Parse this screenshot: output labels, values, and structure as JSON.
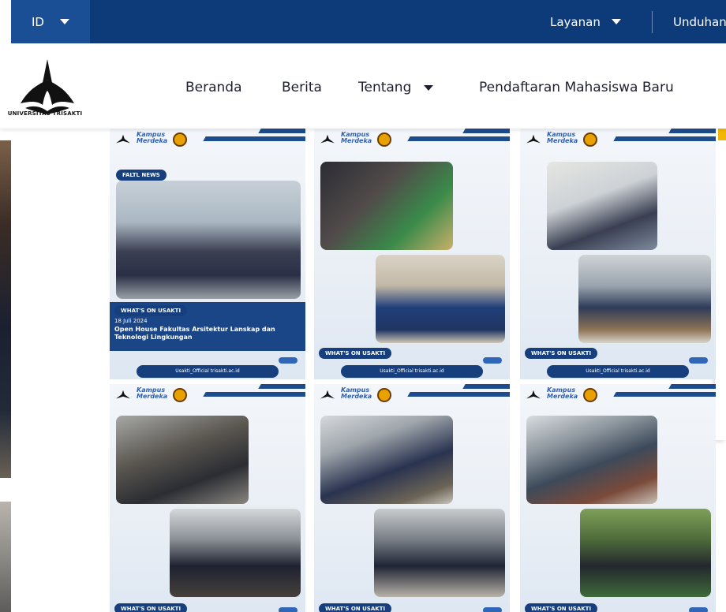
{
  "topbar": {
    "language": "ID",
    "layanan": "Layanan",
    "unduhan": "Unduhan"
  },
  "header": {
    "logo_text": "UNIVERSITAS TRISAKTI",
    "nav": {
      "beranda": "Beranda",
      "berita": "Berita",
      "tentang": "Tentang",
      "pendaftaran": "Pendaftaran Mahasiswa Baru"
    }
  },
  "tiles": {
    "t1": {
      "tag": "FALTL NEWS",
      "badge": "WHAT'S ON USAKTI",
      "date": "18 Juli 2024",
      "title": "Open House Fakultas Arsitektur Lanskap dan Teknologi Lingkungan",
      "social": "Usakti_Official  trisakti.ac.id"
    },
    "t2": {
      "badge": "WHAT'S ON USAKTI",
      "social": "Usakti_Official  trisakti.ac.id"
    },
    "t3": {
      "badge": "WHAT'S ON USAKTI",
      "social": "Usakti_Official  trisakti.ac.id"
    },
    "t4": {
      "badge": "WHAT'S ON USAKTI"
    },
    "t5": {
      "badge": "WHAT'S ON USAKTI"
    },
    "t6": {
      "badge": "WHAT'S ON USAKTI"
    }
  },
  "brand": {
    "kampus": "Kampus",
    "merdeka": "Merdeka"
  },
  "colors": {
    "navy": "#0d3b7a",
    "accent": "#f2b705"
  }
}
